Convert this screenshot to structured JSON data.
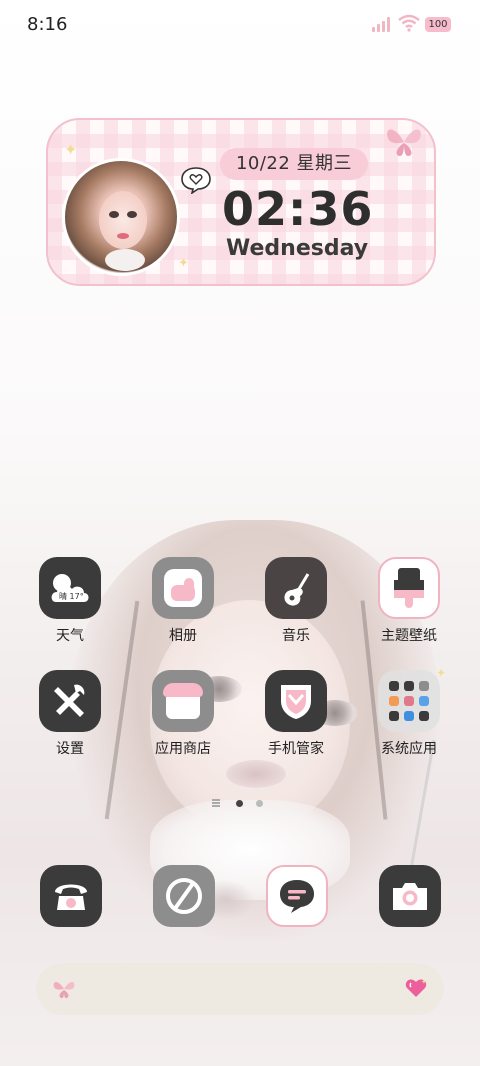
{
  "status": {
    "time": "8:16",
    "battery": "100",
    "icons": [
      "signal-icon",
      "wifi-icon",
      "battery-icon"
    ]
  },
  "widget": {
    "date": "10/22 星期三",
    "clock": "02:36",
    "weekday": "Wednesday",
    "accent": "#f9cdd8"
  },
  "apps": [
    {
      "label": "天气",
      "icon": "weather-icon",
      "badge": "晴 17°"
    },
    {
      "label": "相册",
      "icon": "gallery-icon"
    },
    {
      "label": "音乐",
      "icon": "guitar-icon"
    },
    {
      "label": "主题壁纸",
      "icon": "theme-brush-icon"
    },
    {
      "label": "设置",
      "icon": "tools-icon"
    },
    {
      "label": "应用商店",
      "icon": "store-icon"
    },
    {
      "label": "手机管家",
      "icon": "shield-icon"
    },
    {
      "label": "系统应用",
      "icon": "folder-icon"
    }
  ],
  "pager": {
    "pages": 3,
    "current": 2
  },
  "dock": [
    {
      "icon": "phone-icon"
    },
    {
      "icon": "browser-icon"
    },
    {
      "icon": "messages-icon"
    },
    {
      "icon": "camera-icon"
    }
  ],
  "search": {
    "left_icon": "butterfly-icon",
    "right_icon": "heart-icon"
  }
}
